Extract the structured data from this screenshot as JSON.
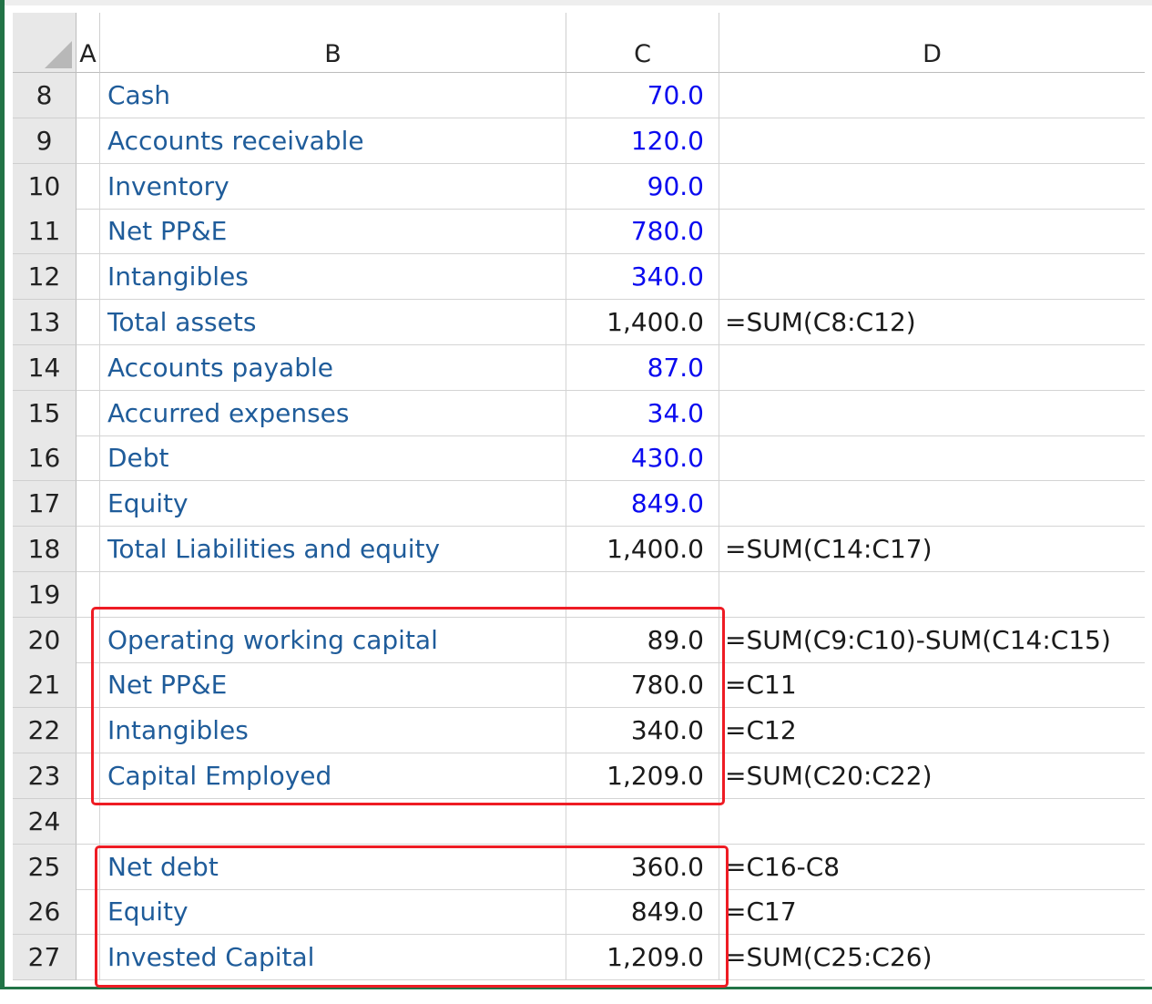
{
  "columns": {
    "A": "A",
    "B": "B",
    "C": "C",
    "D": "D"
  },
  "rows": [
    {
      "num": "8",
      "label": "Cash",
      "value": "70.0",
      "input": true,
      "formula": ""
    },
    {
      "num": "9",
      "label": "Accounts receivable",
      "value": "120.0",
      "input": true,
      "formula": ""
    },
    {
      "num": "10",
      "label": "Inventory",
      "value": "90.0",
      "input": true,
      "formula": ""
    },
    {
      "num": "11",
      "label": "Net PP&E",
      "value": "780.0",
      "input": true,
      "formula": ""
    },
    {
      "num": "12",
      "label": "Intangibles",
      "value": "340.0",
      "input": true,
      "formula": ""
    },
    {
      "num": "13",
      "label": "Total assets",
      "value": "1,400.0",
      "input": false,
      "formula": "=SUM(C8:C12)"
    },
    {
      "num": "14",
      "label": "Accounts payable",
      "value": "87.0",
      "input": true,
      "formula": ""
    },
    {
      "num": "15",
      "label": "Accurred expenses",
      "value": "34.0",
      "input": true,
      "formula": ""
    },
    {
      "num": "16",
      "label": "Debt",
      "value": "430.0",
      "input": true,
      "formula": ""
    },
    {
      "num": "17",
      "label": "Equity",
      "value": "849.0",
      "input": true,
      "formula": ""
    },
    {
      "num": "18",
      "label": "Total Liabilities and equity",
      "value": "1,400.0",
      "input": false,
      "formula": "=SUM(C14:C17)"
    },
    {
      "num": "19",
      "label": "",
      "value": "",
      "input": false,
      "formula": ""
    },
    {
      "num": "20",
      "label": "Operating working capital",
      "value": "89.0",
      "input": false,
      "formula": "=SUM(C9:C10)-SUM(C14:C15)"
    },
    {
      "num": "21",
      "label": "Net PP&E",
      "value": "780.0",
      "input": false,
      "formula": "=C11"
    },
    {
      "num": "22",
      "label": "Intangibles",
      "value": "340.0",
      "input": false,
      "formula": "=C12"
    },
    {
      "num": "23",
      "label": "Capital Employed",
      "value": "1,209.0",
      "input": false,
      "formula": "=SUM(C20:C22)"
    },
    {
      "num": "24",
      "label": "",
      "value": "",
      "input": false,
      "formula": ""
    },
    {
      "num": "25",
      "label": "Net debt",
      "value": "360.0",
      "input": false,
      "formula": "=C16-C8"
    },
    {
      "num": "26",
      "label": "Equity",
      "value": "849.0",
      "input": false,
      "formula": "=C17"
    },
    {
      "num": "27",
      "label": "Invested Capital",
      "value": "1,209.0",
      "input": false,
      "formula": "=SUM(C25:C26)"
    }
  ],
  "colors": {
    "label_text": "#1f5c9a",
    "input_value": "#0b0bef",
    "highlight_border": "#ee1c24",
    "window_accent": "#217346"
  }
}
